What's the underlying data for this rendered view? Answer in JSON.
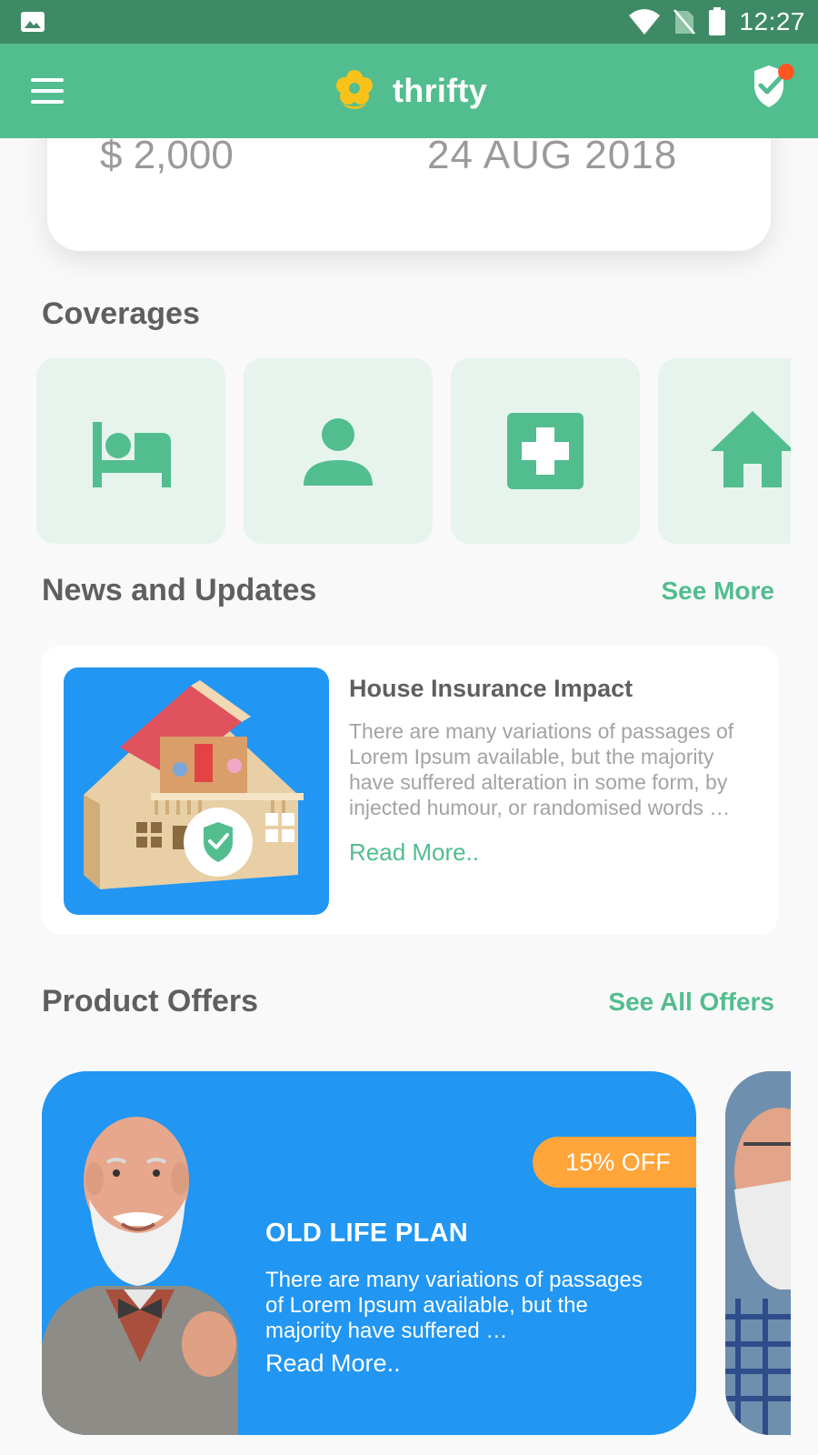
{
  "status_bar": {
    "time": "12:27",
    "icons": [
      "image-icon",
      "wifi-icon",
      "no-sim-icon",
      "battery-icon"
    ]
  },
  "app_bar": {
    "brand": "thrifty",
    "menu_icon": "hamburger-menu-icon",
    "logo_icon": "flower-logo-icon",
    "action_icon": "shield-check-icon",
    "badge_color": "#ff5722"
  },
  "top_card": {
    "amount": "$ 2,000",
    "date": "24 AUG 2018"
  },
  "coverages": {
    "title": "Coverages",
    "items": [
      {
        "icon": "bed-icon"
      },
      {
        "icon": "person-icon"
      },
      {
        "icon": "medical-cross-icon"
      },
      {
        "icon": "home-icon"
      }
    ]
  },
  "news": {
    "title": "News and Updates",
    "see_more": "See More",
    "items": [
      {
        "title": "House Insurance Impact",
        "text": "There are many variations of passages of Lorem Ipsum available, but the majority have suffered alteration in some form, by injected humour, or randomised words …",
        "read_more": "Read More.."
      }
    ]
  },
  "offers": {
    "title": "Product Offers",
    "see_all": "See All Offers",
    "items": [
      {
        "badge": "15% OFF",
        "title": "OLD LIFE PLAN",
        "text": "There are many variations of passages of Lorem Ipsum available, but the majority have suffered …",
        "read_more": "Read More.."
      }
    ]
  },
  "colors": {
    "status_bar": "#3f8a66",
    "primary": "#52bd8f",
    "tile_bg": "#e7f4ee",
    "offer_blue": "#2196f3",
    "badge_orange": "#ffa53a",
    "logo_yellow": "#f9c21a"
  }
}
